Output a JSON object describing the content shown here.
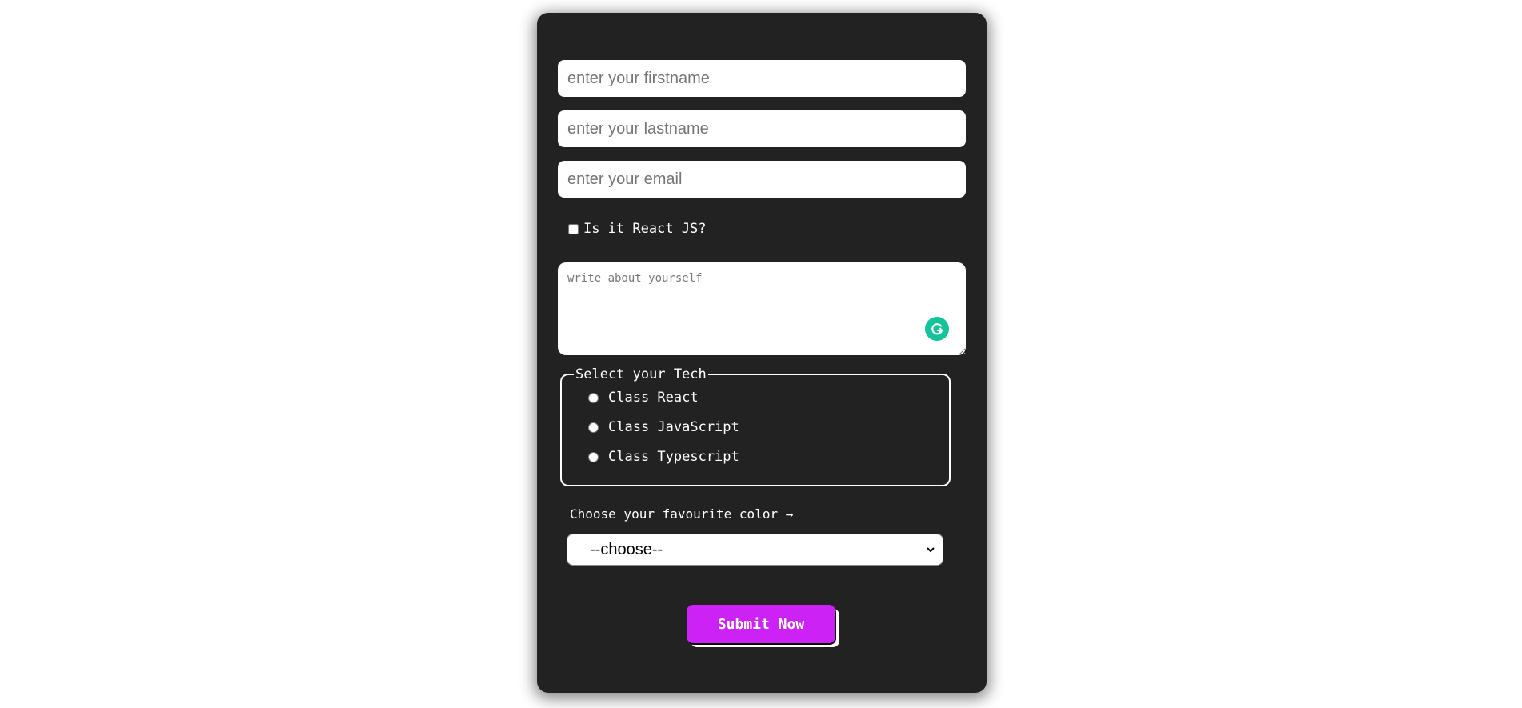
{
  "form": {
    "firstname": {
      "value": "",
      "placeholder": "enter your firstname"
    },
    "lastname": {
      "value": "",
      "placeholder": "enter your lastname"
    },
    "email": {
      "value": "",
      "placeholder": "enter your email"
    },
    "react_checkbox": {
      "label": "Is it React JS?",
      "checked": false
    },
    "about": {
      "value": "",
      "placeholder": "write about yourself"
    },
    "tech": {
      "legend": "Select your Tech",
      "options": [
        {
          "label": "Class React",
          "checked": false
        },
        {
          "label": "Class JavaScript",
          "checked": false
        },
        {
          "label": "Class Typescript",
          "checked": false
        }
      ]
    },
    "color": {
      "label": "Choose your favourite color →",
      "selected": "--choose--"
    },
    "submit_label": "Submit Now"
  },
  "colors": {
    "panel": "#222222",
    "accent": "#cc22f5",
    "grammarly": "#15c39a"
  }
}
